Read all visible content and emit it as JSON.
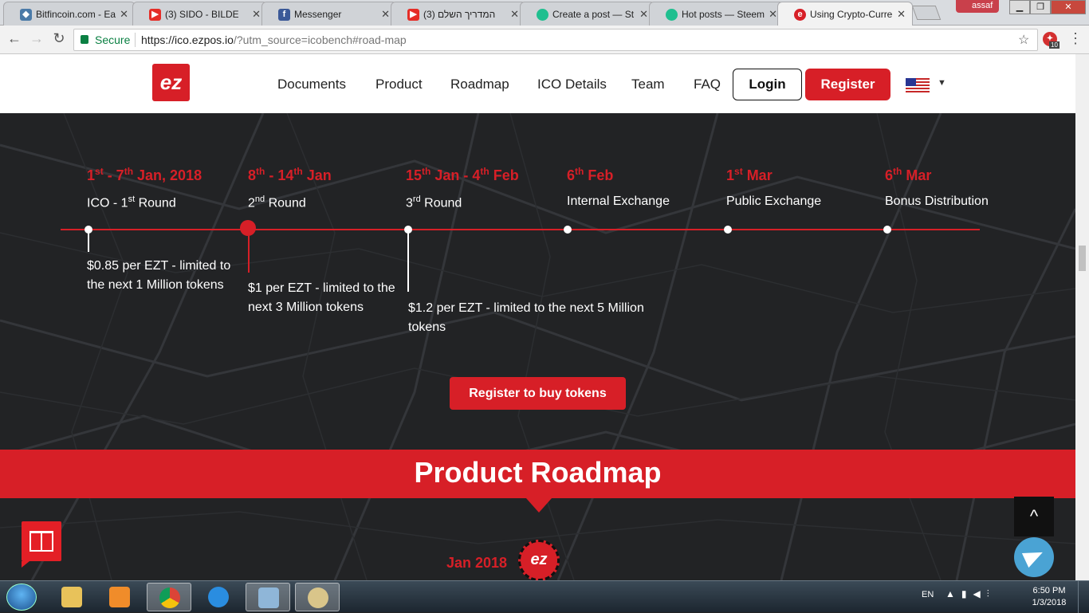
{
  "browser": {
    "tabs": [
      {
        "title": "Bitfincoin.com - Ea",
        "icon": "shield-icon",
        "color": "#4a7aa8"
      },
      {
        "title": "(3) SIDO - BILDE",
        "icon": "youtube-icon",
        "color": "#e52d27",
        "audio": "🔊"
      },
      {
        "title": "Messenger",
        "icon": "facebook-icon",
        "color": "#3b5998"
      },
      {
        "title": "המדריך השלם (3)",
        "icon": "youtube-icon",
        "color": "#e52d27"
      },
      {
        "title": "Create a post — St",
        "icon": "steemit-icon",
        "color": "#1fbf8f"
      },
      {
        "title": "Hot posts — Steem",
        "icon": "steemit-icon",
        "color": "#1fbf8f"
      },
      {
        "title": "Using Crypto-Curre",
        "icon": "ezpos-icon",
        "color": "#d71f27",
        "active": true
      }
    ],
    "profile_name": "assaf",
    "secure_label": "Secure",
    "url_host": "https://ico.ezpos.io",
    "url_rest": "/?utm_source=icobench#road-map",
    "extension_badge": "10"
  },
  "site": {
    "logo_text": "ez",
    "nav": [
      "Documents",
      "Product",
      "Roadmap",
      "ICO Details",
      "Team",
      "FAQ"
    ],
    "login_label": "Login",
    "register_label": "Register",
    "language_flag": "us-flag-icon"
  },
  "timeline": [
    {
      "d1": "1",
      "s1": "st",
      "d2": " - 7",
      "s2": "th",
      "d3": " Jan, 2018",
      "n1": "ICO - 1",
      "ns": "st",
      "n2": " Round",
      "price": "$0.85 per EZT - limited to the next 1 Million tokens"
    },
    {
      "d1": "8",
      "s1": "th",
      "d2": " - 14",
      "s2": "th",
      "d3": " Jan",
      "n1": "2",
      "ns": "nd",
      "n2": " Round",
      "price": "$1 per EZT - limited to the next 3 Million tokens"
    },
    {
      "d1": "15",
      "s1": "th",
      "d2": " Jan - 4",
      "s2": "th",
      "d3": " Feb",
      "n1": "3",
      "ns": "rd",
      "n2": " Round",
      "price": "$1.2 per EZT - limited to the next 5 Million tokens"
    },
    {
      "d1": "6",
      "s1": "th",
      "d2": " Feb",
      "s2": "",
      "d3": "",
      "n1": "Internal Exchange",
      "ns": "",
      "n2": ""
    },
    {
      "d1": "1",
      "s1": "st",
      "d2": " Mar",
      "s2": "",
      "d3": "",
      "n1": "Public Exchange",
      "ns": "",
      "n2": ""
    },
    {
      "d1": "6",
      "s1": "th",
      "d2": " Mar",
      "s2": "",
      "d3": "",
      "n1": "Bonus Distribution",
      "ns": "",
      "n2": ""
    }
  ],
  "buy_button": "Register to buy tokens",
  "product_roadmap": {
    "title": "Product Roadmap",
    "first_date": "Jan 2018",
    "logo_text": "ez"
  },
  "floating": {
    "to_top": "^"
  },
  "taskbar": {
    "lang": "EN",
    "time": "6:50 PM",
    "date": "1/3/2018"
  },
  "colors": {
    "brand_red": "#d71f27",
    "page_bg": "#222325"
  }
}
